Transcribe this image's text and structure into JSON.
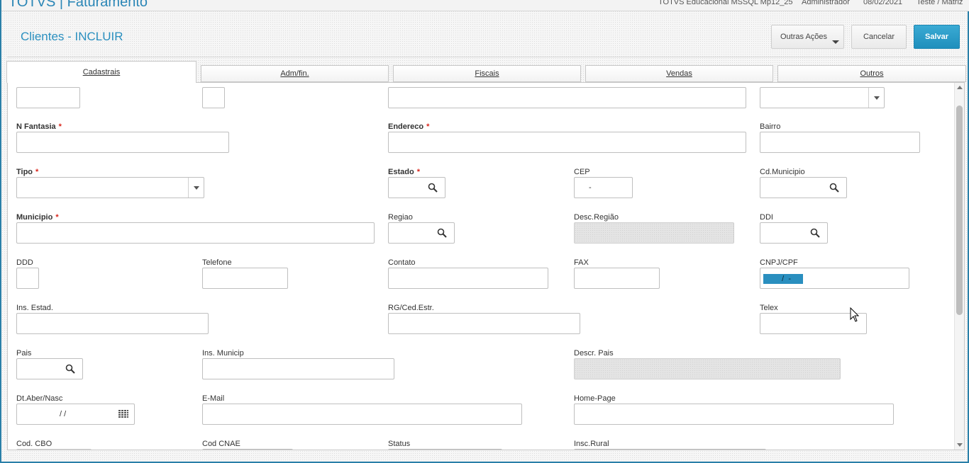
{
  "app": {
    "title": "TOTVS | Faturamento",
    "environment": "TOTVS Educacional MSSQL Mp12_25",
    "user": "Administrador",
    "date": "08/02/2021",
    "branch": "Teste / Matriz"
  },
  "header": {
    "title": "Clientes - INCLUIR",
    "other_actions": "Outras Ações",
    "cancel": "Cancelar",
    "save": "Salvar"
  },
  "tabs": [
    "Cadastrais",
    "Adm/fin.",
    "Fiscais",
    "Vendas",
    "Outros"
  ],
  "fields": {
    "n_fantasia": "N Fantasia",
    "endereco": "Endereco",
    "bairro": "Bairro",
    "tipo": "Tipo",
    "estado": "Estado",
    "cep": "CEP",
    "cep_value": "-",
    "cd_municipio": "Cd.Municipio",
    "municipio": "Municipio",
    "regiao": "Regiao",
    "desc_regiao": "Desc.Região",
    "ddi": "DDI",
    "ddd": "DDD",
    "telefone": "Telefone",
    "contato": "Contato",
    "fax": "FAX",
    "cnpj_cpf": "CNPJ/CPF",
    "cnpj_value": "   /  -",
    "ins_estad": "Ins. Estad.",
    "rg_ced": "RG/Ced.Estr.",
    "telex": "Telex",
    "pais": "Pais",
    "ins_municip": "Ins. Municip",
    "descr_pais": "Descr. Pais",
    "dt_aber": "Dt.Aber/Nasc",
    "dt_value": "/ /",
    "email": "E-Mail",
    "home_page": "Home-Page",
    "cod_cbo": "Cod. CBO",
    "cod_cnae": "Cod CNAE",
    "status": "Status",
    "insc_rural": "Insc.Rural",
    "required_mark": "*"
  },
  "colors": {
    "accent": "#2a8fbf",
    "save_button": "#1f8fbc",
    "required": "#d9261c"
  }
}
